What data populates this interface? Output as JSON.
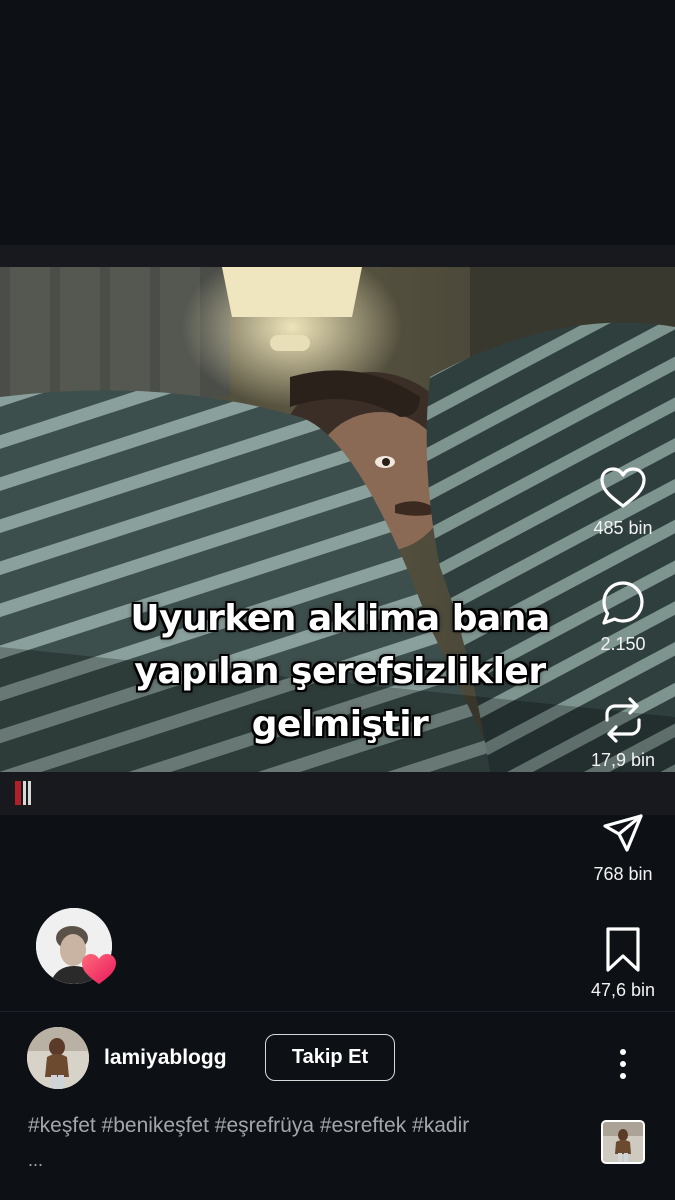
{
  "video": {
    "caption_lines": [
      "Uyurken aklima bana",
      "yapılan şerefsizlikler",
      "gelmiştir"
    ]
  },
  "actions": {
    "like_count": "485 bin",
    "comment_count": "2.150",
    "repost_count": "17,9 bin",
    "share_count": "768 bin",
    "save_count": "47,6 bin"
  },
  "author": {
    "username": "lamiyablogg",
    "follow_label": "Takip Et"
  },
  "description": {
    "hashtags": "#keşfet #benikeşfet #eşrefrüya #esreftek #kadir",
    "more": "..."
  },
  "colors": {
    "background": "#0d1015",
    "text": "#ffffff",
    "muted_text": "#a3a6ab",
    "heart_badge": "#ff3b6b"
  },
  "icons": [
    "heart-icon",
    "comment-icon",
    "repost-icon",
    "send-icon",
    "bookmark-icon",
    "more-vertical-icon"
  ]
}
